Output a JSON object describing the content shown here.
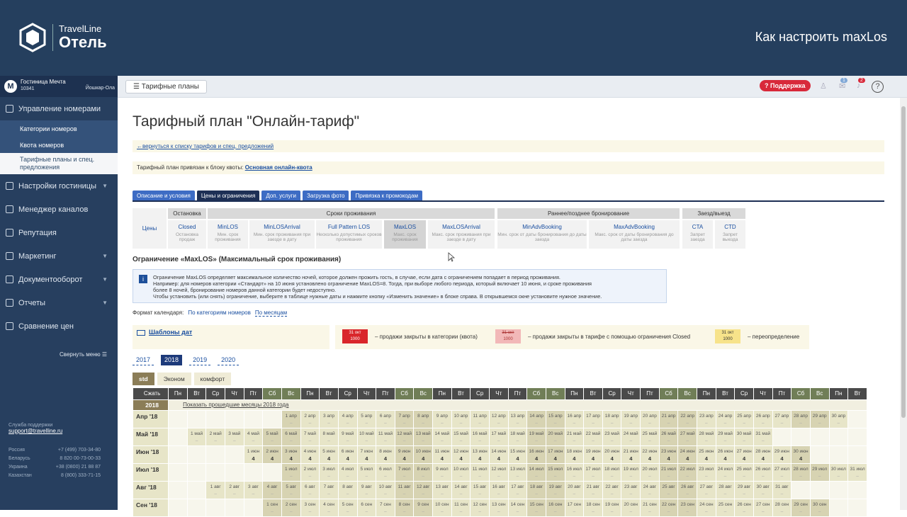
{
  "brand": {
    "line1": "TravelLine",
    "line2": "Отель"
  },
  "video_title": "Как настроить maxLos",
  "hotel": {
    "avatar": "М",
    "name": "Гостиница Мечта",
    "id": "10341",
    "city": "Йошкар-Ола"
  },
  "sidebar": {
    "items": [
      {
        "label": "Управление номерами"
      },
      {
        "label": "Настройки гостиницы"
      },
      {
        "label": "Менеджер каналов"
      },
      {
        "label": "Репутация"
      },
      {
        "label": "Маркетинг"
      },
      {
        "label": "Документооборот"
      },
      {
        "label": "Отчеты"
      },
      {
        "label": "Сравнение цен"
      }
    ],
    "subitems": [
      {
        "label": "Категории номеров"
      },
      {
        "label": "Квота номеров"
      },
      {
        "label": "Тарифные планы и спец. предложения"
      }
    ],
    "collapse": "Свернуть меню",
    "support_label": "Служба поддержки",
    "support_email": "support@travelline.ru",
    "phones": [
      {
        "c": "Россия",
        "p": "+7 (499) 703-34-80"
      },
      {
        "c": "Беларусь",
        "p": "8 820 00-73-00-33"
      },
      {
        "c": "Украина",
        "p": "+38 (0800) 21 88 87"
      },
      {
        "c": "Казахстан",
        "p": "8 (800) 333-71-15"
      }
    ]
  },
  "topbar": {
    "tariffs_button": "Тарифные планы",
    "support": "Поддержка",
    "notif1": "1",
    "notif2": "2"
  },
  "page": {
    "title": "Тарифный план \"Онлайн-тариф\"",
    "back_link": "←вернуться к списку тарифов и спец. предложений",
    "quota_prefix": "Тарифный план привязан к блоку квоты:",
    "quota_link": "Основная онлайн-квота",
    "tabs": [
      "Описание и условия",
      "Цены и ограничения",
      "Доп. услуги",
      "Загрузка фото",
      "Привязка к промокодам"
    ],
    "groups": [
      "Остановка",
      "Сроки проживания",
      "Раннее/позднее бронирование",
      "Заезд/выезд"
    ],
    "prices_label": "Цены",
    "restrictions": [
      {
        "t": "Closed",
        "s": "Остановка продаж"
      },
      {
        "t": "MinLOS",
        "s": "Мин. срок проживания"
      },
      {
        "t": "MinLOSArrival",
        "s": "Мин. срок проживания при заезде в дату"
      },
      {
        "t": "Full Pattern LOS",
        "s": "Несколько допустимых сроков проживания"
      },
      {
        "t": "MaxLOS",
        "s": "Макс. срок проживания"
      },
      {
        "t": "MaxLOSArrival",
        "s": "Макс. срок проживания при заезде в дату"
      },
      {
        "t": "MinAdvBooking",
        "s": "Мин. срок от даты бронирования до даты заезда"
      },
      {
        "t": "MaxAdvBooking",
        "s": "Макс. срок от даты бронирования до даты заезда"
      },
      {
        "t": "CTA",
        "s": "Запрет заезда"
      },
      {
        "t": "CTD",
        "s": "Запрет выезда"
      }
    ],
    "section_title": "Ограничение «MaxLOS» (Максимальный срок проживания)",
    "info_icon": "i",
    "info": [
      "Ограничение MaxLOS определяет максимальное количество ночей, которое должен прожить гость, в случае, если дата с ограничением попадает в период проживания.",
      "Например: для номеров категории «Стандарт» на 10 июня установлено ограничение MaxLOS=8. Тогда, при выборе любого периода, который включает 10 июня, и сроке проживания",
      "более 8 ночей, бронирование номеров данной категории будет недоступно.",
      "Чтобы установить (или снять) ограничение, выберите в таблице нужные даты и нажмите кнопку «Изменить значение» в блоке справа. В открывшемся окне установите нужное значение."
    ],
    "format_label": "Формат календаря:",
    "format_opts": [
      "По категориям номеров",
      "По месяцам"
    ],
    "templates_link": "Шаблоны дат",
    "legend": [
      {
        "d": "31 окт",
        "v": "1000",
        "t": "– продажи закрыты в категории (квота)",
        "color": "#d9262b"
      },
      {
        "d": "31 окт",
        "v": "1000",
        "t": "– продажи закрыты в тарифе с помощью ограничения Closed",
        "color": "#f2b8b8"
      },
      {
        "d": "31 окт",
        "v": "1000",
        "t": "– переопределение",
        "color": "#f7e38a"
      }
    ],
    "years": [
      "2017",
      "2018",
      "2019",
      "2020"
    ],
    "categories": [
      "std",
      "Эконом",
      "комфорт"
    ]
  },
  "calendar": {
    "shrink": "Сжать",
    "days": [
      "Пн",
      "Вт",
      "Ср",
      "Чт",
      "Пт",
      "Сб",
      "Вс",
      "Пн",
      "Вт",
      "Ср",
      "Чт",
      "Пт",
      "Сб",
      "Вс",
      "Пн",
      "Вт",
      "Ср",
      "Чт",
      "Пт",
      "Сб",
      "Вс",
      "Пн",
      "Вт",
      "Ср",
      "Чт",
      "Пт",
      "Сб",
      "Вс",
      "Пн",
      "Вт",
      "Ср",
      "Чт",
      "Пт",
      "Сб",
      "Вс",
      "Пн",
      "Вт"
    ],
    "year": "2018",
    "show_past": "Показать прошедшие месяцы 2018 года",
    "months": [
      {
        "label": "Апр '18",
        "abbr": "апр",
        "offset": 6,
        "days": 30,
        "value": "–"
      },
      {
        "label": "Май '18",
        "abbr": "май",
        "offset": 1,
        "days": 31,
        "value": "–"
      },
      {
        "label": "Июн '18",
        "abbr": "июн",
        "offset": 4,
        "days": 30,
        "value": "4"
      },
      {
        "label": "Июл '18",
        "abbr": "июл",
        "offset": 6,
        "days": 31,
        "value": "–"
      },
      {
        "label": "Авг '18",
        "abbr": "авг",
        "offset": 2,
        "days": 31,
        "value": "–"
      },
      {
        "label": "Сен '18",
        "abbr": "сен",
        "offset": 5,
        "days": 30,
        "value": "–"
      }
    ]
  },
  "colors": {
    "topband": "#253f5e",
    "sidebar": "#273f5f",
    "accent": "#3d6cc4",
    "tab_active": "#1d2f55",
    "support": "#d8293a"
  }
}
